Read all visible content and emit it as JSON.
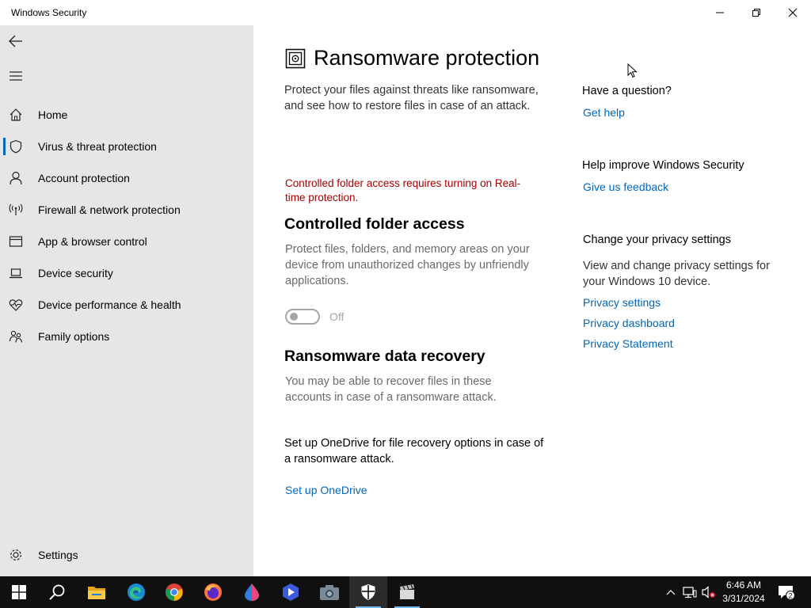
{
  "window": {
    "title": "Windows Security"
  },
  "sidebar": {
    "items": [
      {
        "label": "Home",
        "icon": "home-icon"
      },
      {
        "label": "Virus & threat protection",
        "icon": "shield-icon",
        "active": true
      },
      {
        "label": "Account protection",
        "icon": "person-icon"
      },
      {
        "label": "Firewall & network protection",
        "icon": "antenna-icon"
      },
      {
        "label": "App & browser control",
        "icon": "browser-window-icon"
      },
      {
        "label": "Device security",
        "icon": "laptop-icon"
      },
      {
        "label": "Device performance & health",
        "icon": "heart-pulse-icon"
      },
      {
        "label": "Family options",
        "icon": "family-icon"
      }
    ],
    "settings_label": "Settings"
  },
  "main": {
    "title": "Ransomware protection",
    "intro": "Protect your files against threats like ransomware, and see how to restore files in case of an attack.",
    "warning": "Controlled folder access requires turning on Real-time protection.",
    "cfa": {
      "heading": "Controlled folder access",
      "description": "Protect files, folders, and memory areas on your device from unauthorized changes by unfriendly applications.",
      "toggle_state": "Off"
    },
    "recovery": {
      "heading": "Ransomware data recovery",
      "description": "You may be able to recover files in these accounts in case of a ransomware attack.",
      "onedrive_text": "Set up OneDrive for file recovery options in case of a ransomware attack.",
      "onedrive_link": "Set up OneDrive"
    }
  },
  "aside": {
    "question_heading": "Have a question?",
    "get_help": "Get help",
    "improve_heading": "Help improve Windows Security",
    "feedback": "Give us feedback",
    "privacy_heading": "Change your privacy settings",
    "privacy_desc": "View and change privacy settings for your Windows 10 device.",
    "privacy_settings": "Privacy settings",
    "privacy_dashboard": "Privacy dashboard",
    "privacy_statement": "Privacy Statement"
  },
  "taskbar": {
    "time": "6:46 AM",
    "date": "3/31/2024",
    "notification_count": "2",
    "apps": [
      "windows-start-icon",
      "search-icon",
      "file-explorer-icon",
      "edge-icon",
      "chrome-icon",
      "firefox-icon",
      "drop-app-icon",
      "video-editor-icon",
      "camera-app-icon",
      "windows-security-icon",
      "clapperboard-app-icon"
    ]
  },
  "colors": {
    "accent": "#0067c0",
    "link": "#0067b8",
    "warning": "#a80000",
    "sidebar_bg": "#e6e6e6",
    "taskbar_bg": "#101010"
  }
}
